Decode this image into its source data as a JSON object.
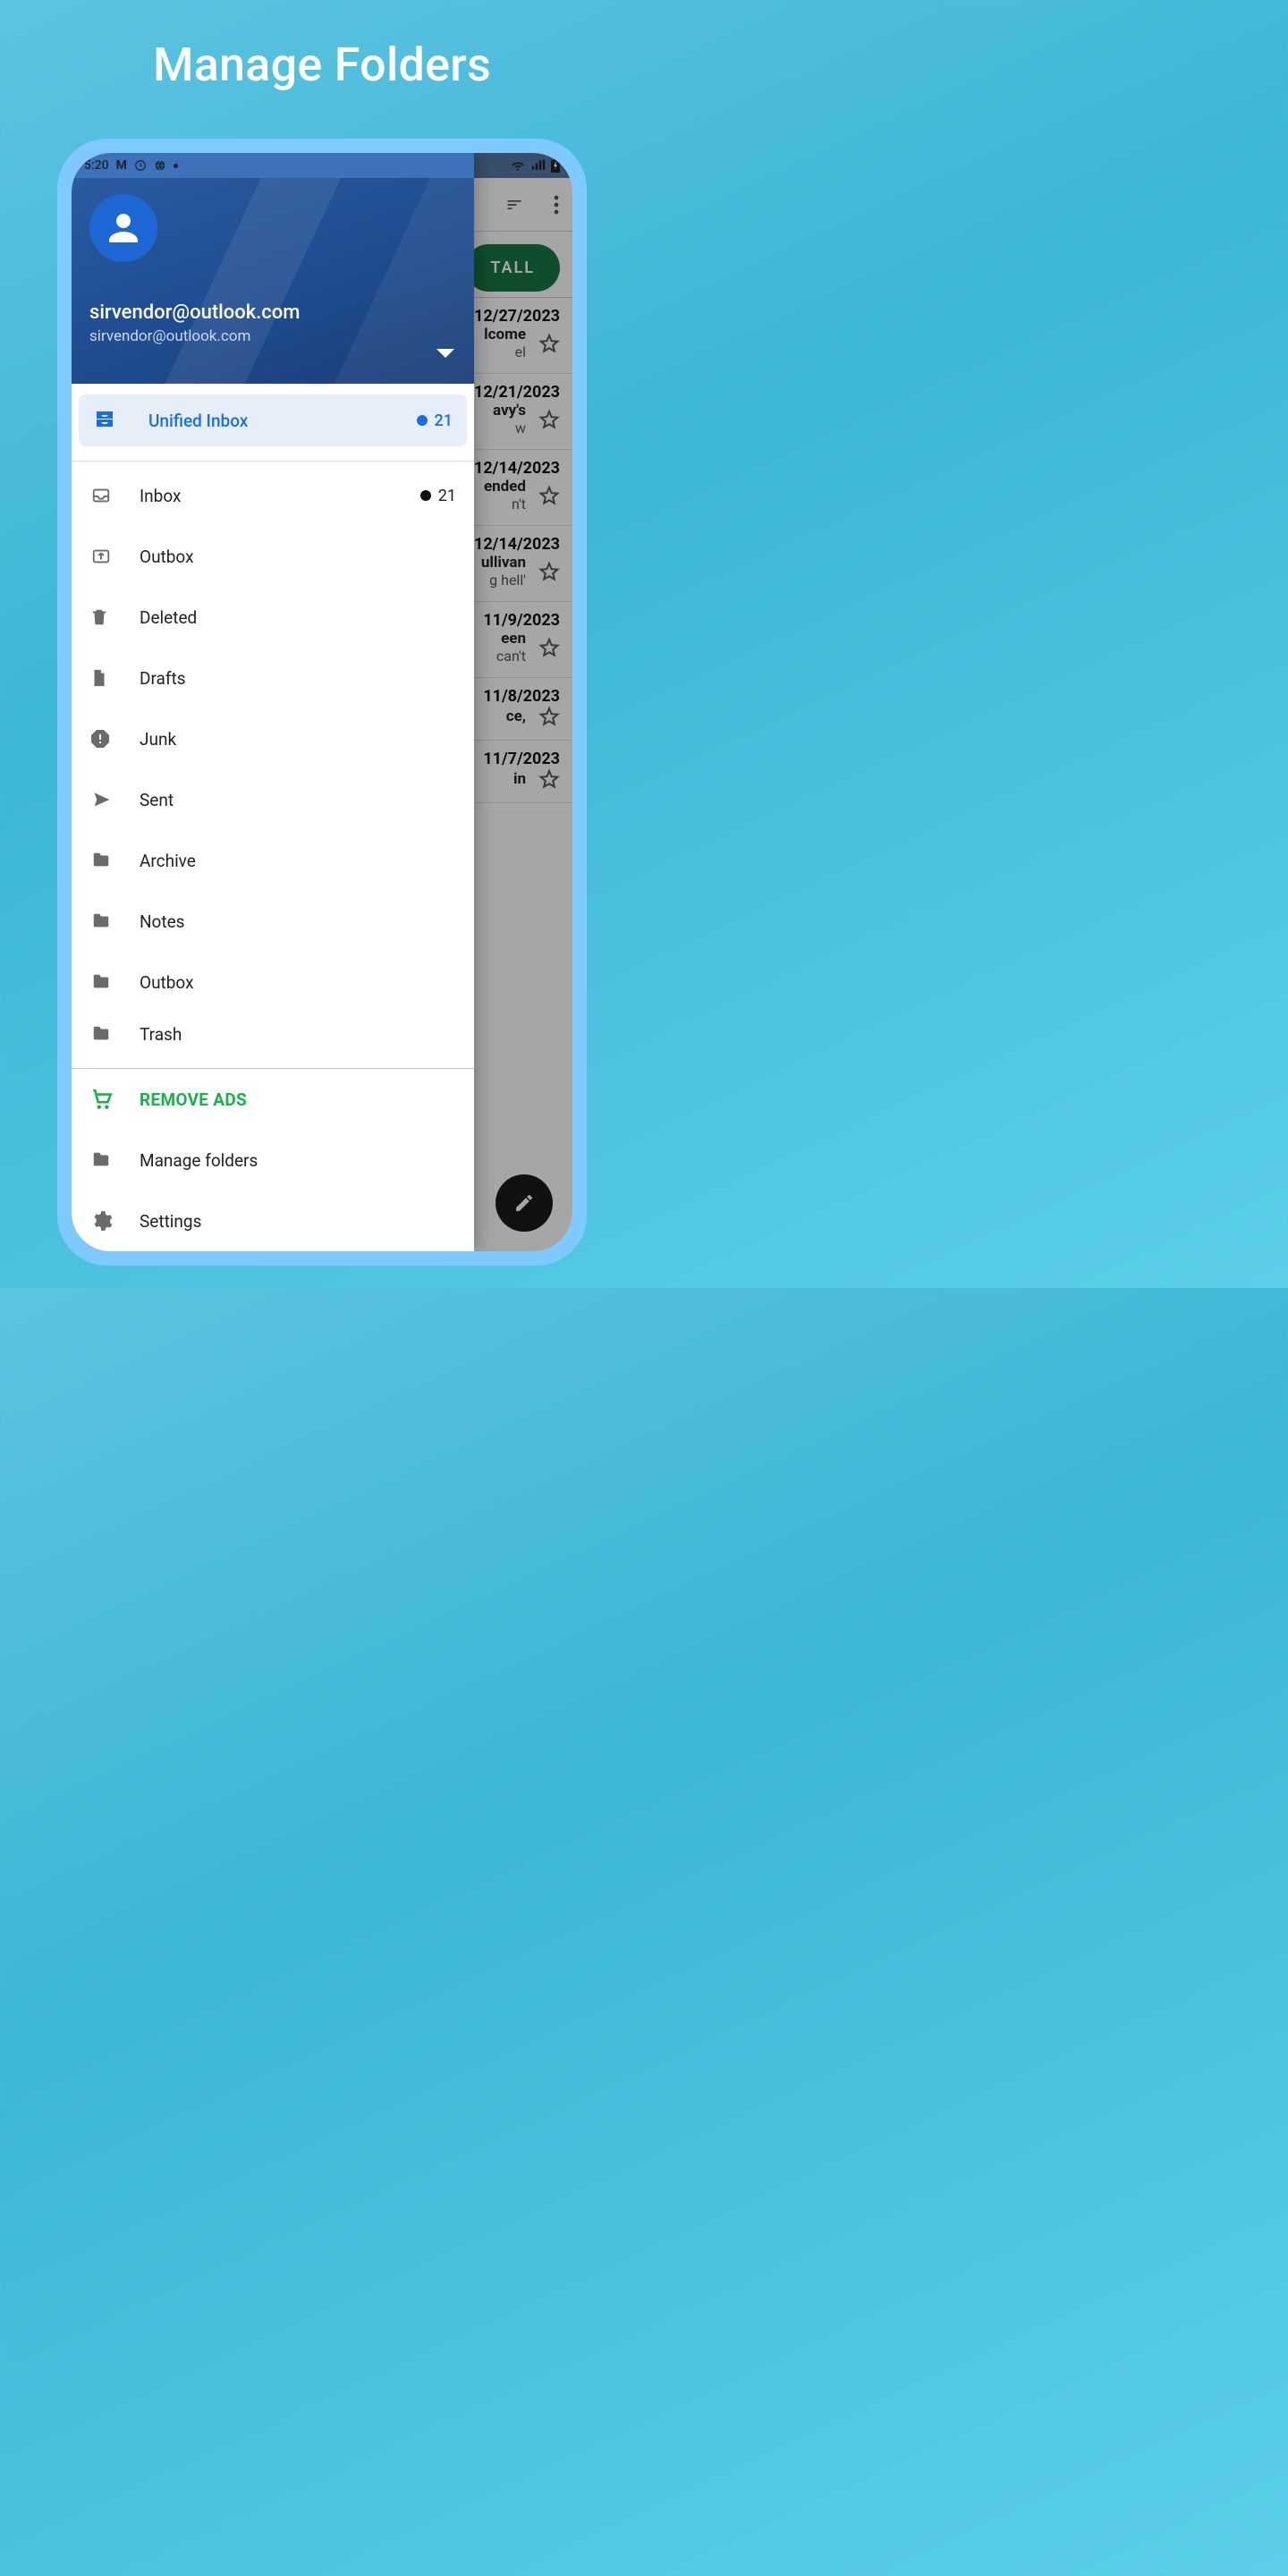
{
  "promo": {
    "title": "Manage Folders"
  },
  "status": {
    "time": "5:20"
  },
  "account": {
    "name": "sirvendor@outlook.com",
    "email": "sirvendor@outlook.com"
  },
  "unified": {
    "label": "Unified Inbox",
    "count": "21"
  },
  "folders": [
    {
      "id": "inbox",
      "label": "Inbox",
      "icon": "inbox",
      "count": "21"
    },
    {
      "id": "outbox",
      "label": "Outbox",
      "icon": "outbox"
    },
    {
      "id": "deleted",
      "label": "Deleted",
      "icon": "trash"
    },
    {
      "id": "drafts",
      "label": "Drafts",
      "icon": "file"
    },
    {
      "id": "junk",
      "label": "Junk",
      "icon": "alert"
    },
    {
      "id": "sent",
      "label": "Sent",
      "icon": "send"
    },
    {
      "id": "archive",
      "label": "Archive",
      "icon": "folder"
    },
    {
      "id": "notes",
      "label": "Notes",
      "icon": "folder"
    },
    {
      "id": "outbox2",
      "label": "Outbox",
      "icon": "folder"
    },
    {
      "id": "trash",
      "label": "Trash",
      "icon": "folder"
    }
  ],
  "removeAds": {
    "label": "REMOVE ADS"
  },
  "manageFolders": {
    "label": "Manage folders"
  },
  "settings": {
    "label": "Settings"
  },
  "install": {
    "label": "TALL"
  },
  "mails": [
    {
      "date": "12/27/2023",
      "sub": "lcome",
      "prev": "el"
    },
    {
      "date": "12/21/2023",
      "sub": "avy's",
      "prev": "w"
    },
    {
      "date": "12/14/2023",
      "sub": "ended",
      "prev": "n't"
    },
    {
      "date": "12/14/2023",
      "sub": "ullivan",
      "prev": "g hell'"
    },
    {
      "date": "11/9/2023",
      "sub": "een",
      "prev": "can't"
    },
    {
      "date": "11/8/2023",
      "sub": "ce,",
      "prev": ""
    },
    {
      "date": "11/7/2023",
      "sub": "in",
      "prev": ""
    }
  ]
}
